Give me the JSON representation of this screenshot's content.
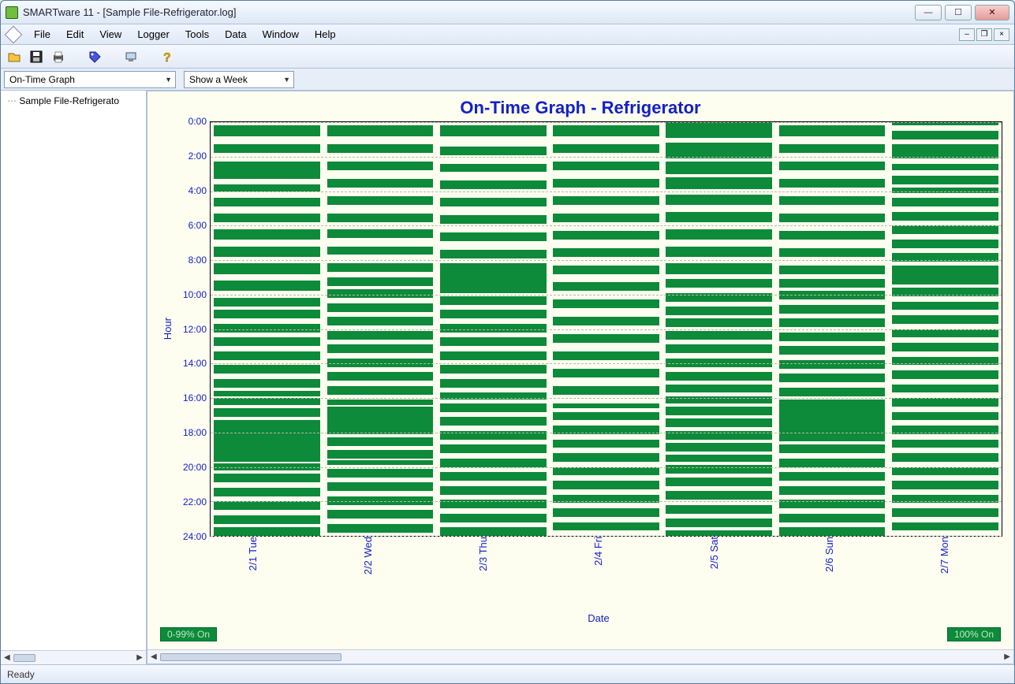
{
  "window": {
    "title": "SMARTware 11 - [Sample File-Refrigerator.log]"
  },
  "menus": [
    "File",
    "Edit",
    "View",
    "Logger",
    "Tools",
    "Data",
    "Window",
    "Help"
  ],
  "toolbar_icons": [
    "open-icon",
    "save-icon",
    "print-icon",
    "tag-icon",
    "device-icon",
    "help-icon"
  ],
  "dropdowns": {
    "graph_type": "On-Time Graph",
    "range": "Show a Week"
  },
  "tree": {
    "item0": "Sample File-Refrigerato"
  },
  "chart": {
    "title": "On-Time Graph - Refrigerator",
    "ylabel": "Hour",
    "xlabel": "Date",
    "legend_left": "0-99% On",
    "legend_right": "100% On"
  },
  "status": "Ready",
  "chart_data": {
    "type": "bar",
    "ylabel": "Hour",
    "xlabel": "Date",
    "yticks": [
      0,
      2,
      4,
      6,
      8,
      10,
      12,
      14,
      16,
      18,
      20,
      22,
      24
    ],
    "ylim": [
      0,
      24
    ],
    "categories": [
      "2/1 Tue",
      "2/2 Wed",
      "2/3 Thu",
      "2/4 Fri",
      "2/5 Sat",
      "2/6 Sun",
      "2/7 Mon"
    ],
    "note": "Each series entry is a list of [start_hour,end_hour] intervals where the unit was On during that day.",
    "series": [
      [
        [
          0.2,
          0.8
        ],
        [
          1.3,
          1.8
        ],
        [
          2.3,
          3.3
        ],
        [
          3.6,
          4.0
        ],
        [
          4.4,
          4.9
        ],
        [
          5.3,
          5.8
        ],
        [
          6.2,
          6.8
        ],
        [
          7.2,
          7.8
        ],
        [
          8.2,
          8.8
        ],
        [
          9.2,
          9.8
        ],
        [
          10.2,
          10.7
        ],
        [
          10.9,
          11.4
        ],
        [
          11.7,
          12.2
        ],
        [
          12.5,
          13.0
        ],
        [
          13.3,
          13.8
        ],
        [
          14.1,
          14.6
        ],
        [
          14.9,
          15.4
        ],
        [
          15.6,
          15.9
        ],
        [
          16.0,
          16.4
        ],
        [
          16.6,
          17.1
        ],
        [
          17.3,
          19.7
        ],
        [
          19.8,
          20.2
        ],
        [
          20.4,
          20.9
        ],
        [
          21.2,
          21.7
        ],
        [
          22.0,
          22.5
        ],
        [
          22.8,
          23.3
        ],
        [
          23.5,
          24.0
        ]
      ],
      [
        [
          0.2,
          0.8
        ],
        [
          1.3,
          1.8
        ],
        [
          2.3,
          2.8
        ],
        [
          3.3,
          3.8
        ],
        [
          4.3,
          4.8
        ],
        [
          5.3,
          5.8
        ],
        [
          6.2,
          6.7
        ],
        [
          7.2,
          7.7
        ],
        [
          8.2,
          8.7
        ],
        [
          9.0,
          9.5
        ],
        [
          9.7,
          10.2
        ],
        [
          10.5,
          11.0
        ],
        [
          11.3,
          11.8
        ],
        [
          12.1,
          12.6
        ],
        [
          12.9,
          13.4
        ],
        [
          13.7,
          14.2
        ],
        [
          14.5,
          15.0
        ],
        [
          15.3,
          15.8
        ],
        [
          16.1,
          16.4
        ],
        [
          16.5,
          18.1
        ],
        [
          18.3,
          18.8
        ],
        [
          19.0,
          19.5
        ],
        [
          19.6,
          19.9
        ],
        [
          20.1,
          20.6
        ],
        [
          20.9,
          21.4
        ],
        [
          21.7,
          22.2
        ],
        [
          22.5,
          23.0
        ],
        [
          23.3,
          23.8
        ]
      ],
      [
        [
          0.2,
          0.8
        ],
        [
          1.4,
          1.9
        ],
        [
          2.4,
          2.9
        ],
        [
          3.4,
          3.9
        ],
        [
          4.4,
          4.9
        ],
        [
          5.4,
          5.9
        ],
        [
          6.4,
          6.9
        ],
        [
          7.4,
          7.9
        ],
        [
          8.2,
          9.9
        ],
        [
          10.1,
          10.6
        ],
        [
          10.9,
          11.4
        ],
        [
          11.7,
          12.2
        ],
        [
          12.5,
          13.0
        ],
        [
          13.3,
          13.8
        ],
        [
          14.1,
          14.6
        ],
        [
          14.9,
          15.4
        ],
        [
          15.7,
          16.1
        ],
        [
          16.3,
          16.8
        ],
        [
          17.1,
          17.6
        ],
        [
          17.9,
          18.4
        ],
        [
          18.7,
          19.2
        ],
        [
          19.5,
          20.0
        ],
        [
          20.3,
          20.8
        ],
        [
          21.1,
          21.6
        ],
        [
          21.9,
          22.4
        ],
        [
          22.7,
          23.2
        ],
        [
          23.5,
          24.0
        ]
      ],
      [
        [
          0.2,
          0.8
        ],
        [
          1.3,
          1.8
        ],
        [
          2.3,
          2.8
        ],
        [
          3.3,
          3.8
        ],
        [
          4.3,
          4.8
        ],
        [
          5.3,
          5.8
        ],
        [
          6.3,
          6.8
        ],
        [
          7.3,
          7.8
        ],
        [
          8.3,
          8.8
        ],
        [
          9.3,
          9.8
        ],
        [
          10.3,
          10.8
        ],
        [
          11.3,
          11.8
        ],
        [
          12.3,
          12.8
        ],
        [
          13.3,
          13.8
        ],
        [
          14.3,
          14.8
        ],
        [
          15.3,
          15.8
        ],
        [
          16.3,
          16.6
        ],
        [
          16.8,
          17.3
        ],
        [
          17.6,
          18.1
        ],
        [
          18.4,
          18.9
        ],
        [
          19.2,
          19.7
        ],
        [
          20.0,
          20.5
        ],
        [
          20.8,
          21.3
        ],
        [
          21.6,
          22.1
        ],
        [
          22.4,
          22.9
        ],
        [
          23.2,
          23.7
        ]
      ],
      [
        [
          0.0,
          0.9
        ],
        [
          1.2,
          2.1
        ],
        [
          2.3,
          3.0
        ],
        [
          3.2,
          3.9
        ],
        [
          4.2,
          4.8
        ],
        [
          5.2,
          5.8
        ],
        [
          6.2,
          6.8
        ],
        [
          7.2,
          7.8
        ],
        [
          8.2,
          8.8
        ],
        [
          9.1,
          9.6
        ],
        [
          9.9,
          10.4
        ],
        [
          10.7,
          11.2
        ],
        [
          11.4,
          11.9
        ],
        [
          12.1,
          12.6
        ],
        [
          12.9,
          13.4
        ],
        [
          13.7,
          14.2
        ],
        [
          14.5,
          15.0
        ],
        [
          15.2,
          15.7
        ],
        [
          15.9,
          16.3
        ],
        [
          16.5,
          17.0
        ],
        [
          17.2,
          17.7
        ],
        [
          17.9,
          18.4
        ],
        [
          18.6,
          19.1
        ],
        [
          19.3,
          19.7
        ],
        [
          19.9,
          20.4
        ],
        [
          20.6,
          21.1
        ],
        [
          21.4,
          21.9
        ],
        [
          22.2,
          22.7
        ],
        [
          23.0,
          23.5
        ],
        [
          23.7,
          24.0
        ]
      ],
      [
        [
          0.2,
          0.8
        ],
        [
          1.3,
          1.8
        ],
        [
          2.3,
          2.8
        ],
        [
          3.3,
          3.8
        ],
        [
          4.3,
          4.8
        ],
        [
          5.3,
          5.8
        ],
        [
          6.3,
          6.8
        ],
        [
          7.3,
          7.8
        ],
        [
          8.3,
          8.8
        ],
        [
          9.1,
          9.6
        ],
        [
          9.8,
          10.3
        ],
        [
          10.6,
          11.1
        ],
        [
          11.4,
          11.9
        ],
        [
          12.2,
          12.7
        ],
        [
          13.0,
          13.5
        ],
        [
          13.8,
          14.3
        ],
        [
          14.6,
          15.1
        ],
        [
          15.4,
          15.9
        ],
        [
          16.1,
          18.5
        ],
        [
          18.7,
          19.2
        ],
        [
          19.5,
          20.0
        ],
        [
          20.3,
          20.8
        ],
        [
          21.1,
          21.6
        ],
        [
          21.9,
          22.4
        ],
        [
          22.7,
          23.2
        ],
        [
          23.5,
          24.0
        ]
      ],
      [
        [
          0.0,
          0.2
        ],
        [
          0.5,
          1.0
        ],
        [
          1.3,
          2.1
        ],
        [
          2.4,
          2.8
        ],
        [
          3.1,
          3.6
        ],
        [
          3.8,
          4.1
        ],
        [
          4.4,
          4.9
        ],
        [
          5.2,
          5.7
        ],
        [
          6.0,
          6.5
        ],
        [
          6.8,
          7.3
        ],
        [
          7.6,
          8.1
        ],
        [
          8.3,
          9.4
        ],
        [
          9.6,
          10.1
        ],
        [
          10.4,
          10.9
        ],
        [
          11.2,
          11.7
        ],
        [
          12.0,
          12.5
        ],
        [
          12.8,
          13.3
        ],
        [
          13.6,
          14.1
        ],
        [
          14.4,
          14.9
        ],
        [
          15.2,
          15.7
        ],
        [
          16.0,
          16.5
        ],
        [
          16.8,
          17.3
        ],
        [
          17.6,
          18.1
        ],
        [
          18.4,
          18.9
        ],
        [
          19.2,
          19.7
        ],
        [
          20.0,
          20.5
        ],
        [
          20.8,
          21.3
        ],
        [
          21.6,
          22.1
        ],
        [
          22.4,
          22.9
        ],
        [
          23.2,
          23.7
        ]
      ]
    ]
  }
}
